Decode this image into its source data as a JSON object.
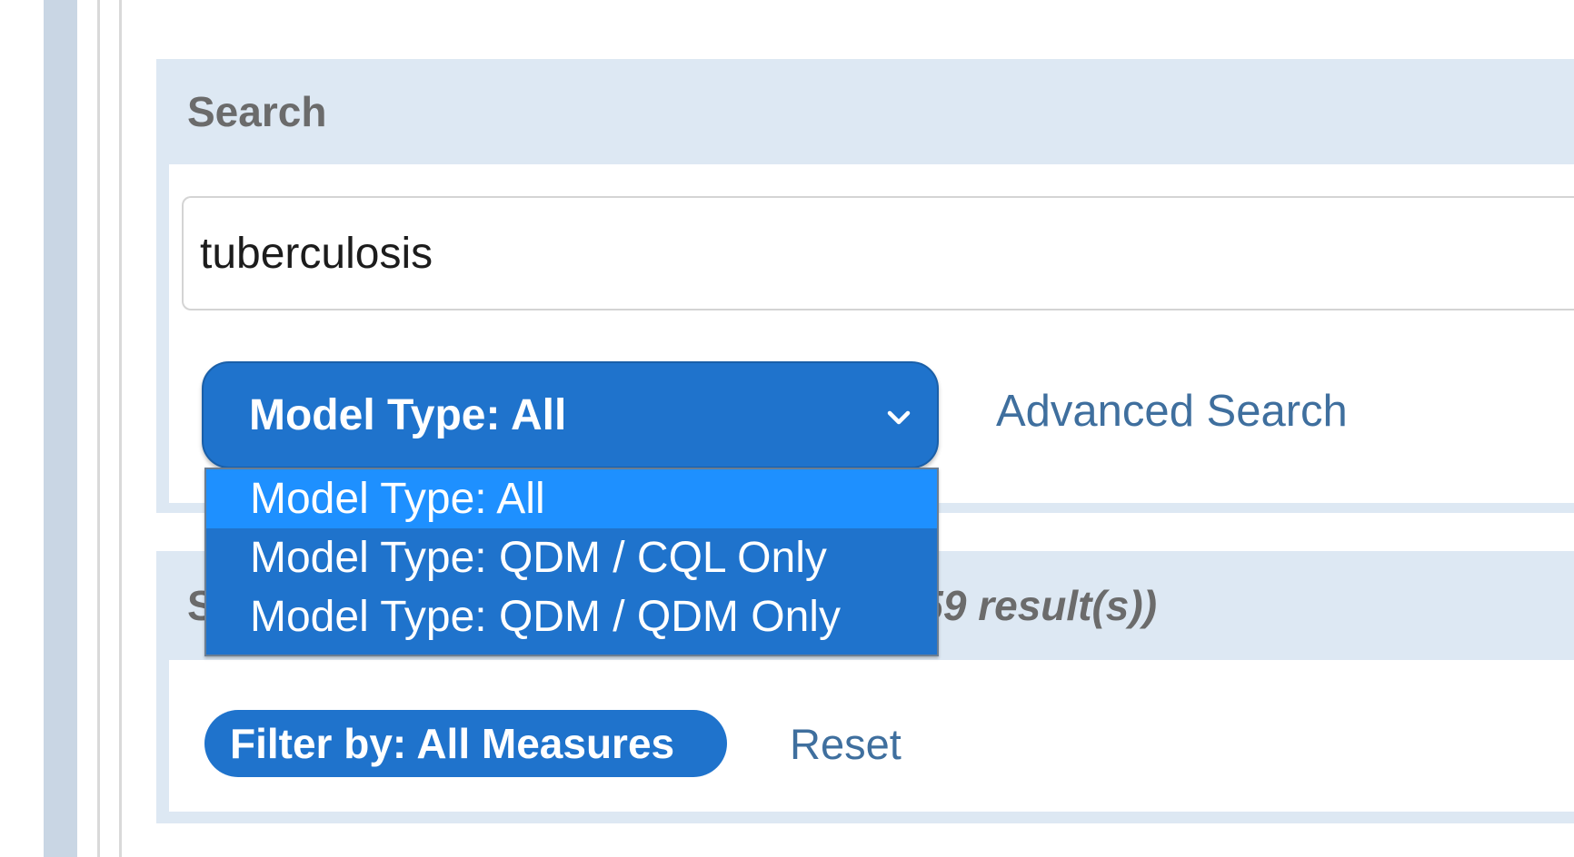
{
  "search_panel": {
    "title": "Search",
    "query_value": "tuberculosis",
    "model_type_selected": "Model Type: All",
    "model_type_options": [
      "Model Type: All",
      "Model Type: QDM / CQL Only",
      "Model Type: QDM / QDM Only"
    ],
    "advanced_search_label": "Advanced Search"
  },
  "results_panel": {
    "title_visible": "S",
    "count_visible": "559 result(s))",
    "filter_label": "Filter by: All Measures",
    "reset_label": "Reset"
  },
  "icons": {
    "dropdown_chevron": "chevron-down-icon"
  },
  "colors": {
    "primary_blue": "#1f73cc",
    "highlight_blue": "#1e90ff",
    "panel_bg": "#dde8f3",
    "link_color": "#3f6f9e",
    "heading_gray": "#6b6b6b"
  }
}
